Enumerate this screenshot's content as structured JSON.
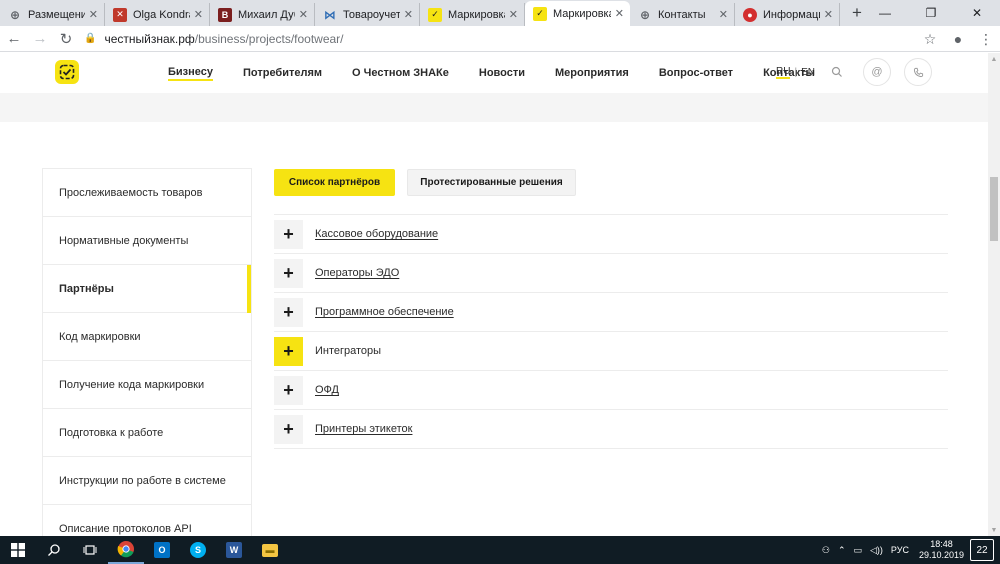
{
  "browser": {
    "tabs": [
      {
        "title": "Размещение с",
        "icon_color": "#5f6368",
        "icon": "globe-icon",
        "active": false
      },
      {
        "title": "Olga Kondraty",
        "icon_color": "#c0392b",
        "icon": "cross-icon",
        "active": false
      },
      {
        "title": "Михаил Дуби",
        "icon_color": "#7b1f1f",
        "icon": "letter-b-icon",
        "active": false
      },
      {
        "title": "Товароучетн",
        "icon_color": "#2f6db5",
        "icon": "butterfly-icon",
        "active": false
      },
      {
        "title": "Маркировка",
        "icon_color": "#f6e312",
        "icon": "znak-logo-icon",
        "active": false
      },
      {
        "title": "Маркировка",
        "icon_color": "#f6e312",
        "icon": "znak-logo-icon",
        "active": true
      },
      {
        "title": "Контакты",
        "icon_color": "#5f6368",
        "icon": "globe-icon",
        "active": false
      },
      {
        "title": "Информацио",
        "icon_color": "#d32f2f",
        "icon": "red-badge-icon",
        "active": false
      }
    ],
    "url_host": "честныйзнак.рф",
    "url_path": "/business/projects/footwear/"
  },
  "site": {
    "nav": [
      {
        "label": "Бизнесу",
        "current": true
      },
      {
        "label": "Потребителям",
        "current": false
      },
      {
        "label": "О Честном ЗНАКе",
        "current": false
      },
      {
        "label": "Новости",
        "current": false
      },
      {
        "label": "Мероприятия",
        "current": false
      },
      {
        "label": "Вопрос-ответ",
        "current": false
      },
      {
        "label": "Контакты",
        "current": false
      }
    ],
    "lang_ru": "RU",
    "lang_en": "EN",
    "accent_color": "#f6e312"
  },
  "sidebar": {
    "items": [
      {
        "label": "Прослеживаемость товаров",
        "active": false
      },
      {
        "label": "Нормативные документы",
        "active": false
      },
      {
        "label": "Партнёры",
        "active": true
      },
      {
        "label": "Код маркировки",
        "active": false
      },
      {
        "label": "Получение кода маркировки",
        "active": false
      },
      {
        "label": "Подготовка к работе",
        "active": false
      },
      {
        "label": "Инструкции по работе в системе",
        "active": false
      },
      {
        "label": "Описание протоколов API",
        "active": false
      }
    ]
  },
  "content": {
    "tab_partners": "Список партнёров",
    "tab_tested": "Протестированные решения",
    "accordion": [
      {
        "label": "Кассовое оборудование",
        "highlighted": false
      },
      {
        "label": "Операторы ЭДО",
        "highlighted": false
      },
      {
        "label": "Программное обеспечение",
        "highlighted": false
      },
      {
        "label": "Интеграторы",
        "highlighted": true
      },
      {
        "label": "ОФД",
        "highlighted": false
      },
      {
        "label": "Принтеры этикеток",
        "highlighted": false
      }
    ],
    "plus_symbol": "+"
  },
  "taskbar": {
    "lang": "РУС",
    "time": "18:48",
    "date": "29.10.2019",
    "notifications": "22"
  }
}
